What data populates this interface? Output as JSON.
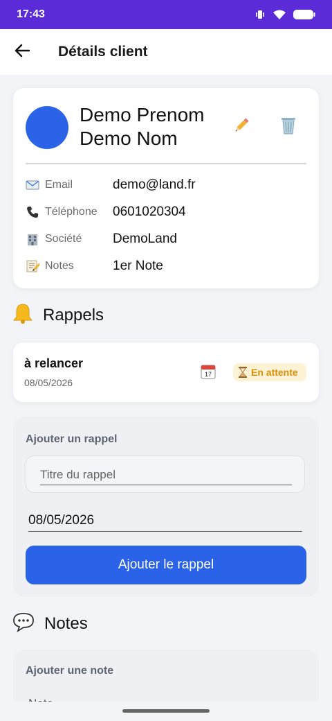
{
  "status_bar": {
    "time": "17:43"
  },
  "app_bar": {
    "title": "Détails client"
  },
  "client": {
    "first_name": "Demo Prenom",
    "last_name": "Demo Nom",
    "avatar_color": "#2a63e8",
    "fields": [
      {
        "icon": "email-icon",
        "label": "Email",
        "value": "demo@land.fr"
      },
      {
        "icon": "phone-icon",
        "label": "Téléphone",
        "value": "0601020304"
      },
      {
        "icon": "company-icon",
        "label": "Société",
        "value": "DemoLand"
      },
      {
        "icon": "notes-icon",
        "label": "Notes",
        "value": "1er Note"
      }
    ]
  },
  "reminders_section": {
    "title": "Rappels",
    "icon": "bell-icon",
    "items": [
      {
        "title": "à relancer",
        "date": "08/05/2026",
        "status": "En attente",
        "status_color": "#d8900a"
      }
    ]
  },
  "add_reminder": {
    "label": "Ajouter un rappel",
    "title_placeholder": "Titre du rappel",
    "date_value": "08/05/2026",
    "button_label": "Ajouter le rappel",
    "button_color": "#2a63e8"
  },
  "notes_section": {
    "title": "Notes",
    "icon": "speech-bubble-icon",
    "add_label": "Ajouter une note",
    "input_hint": "Note"
  }
}
